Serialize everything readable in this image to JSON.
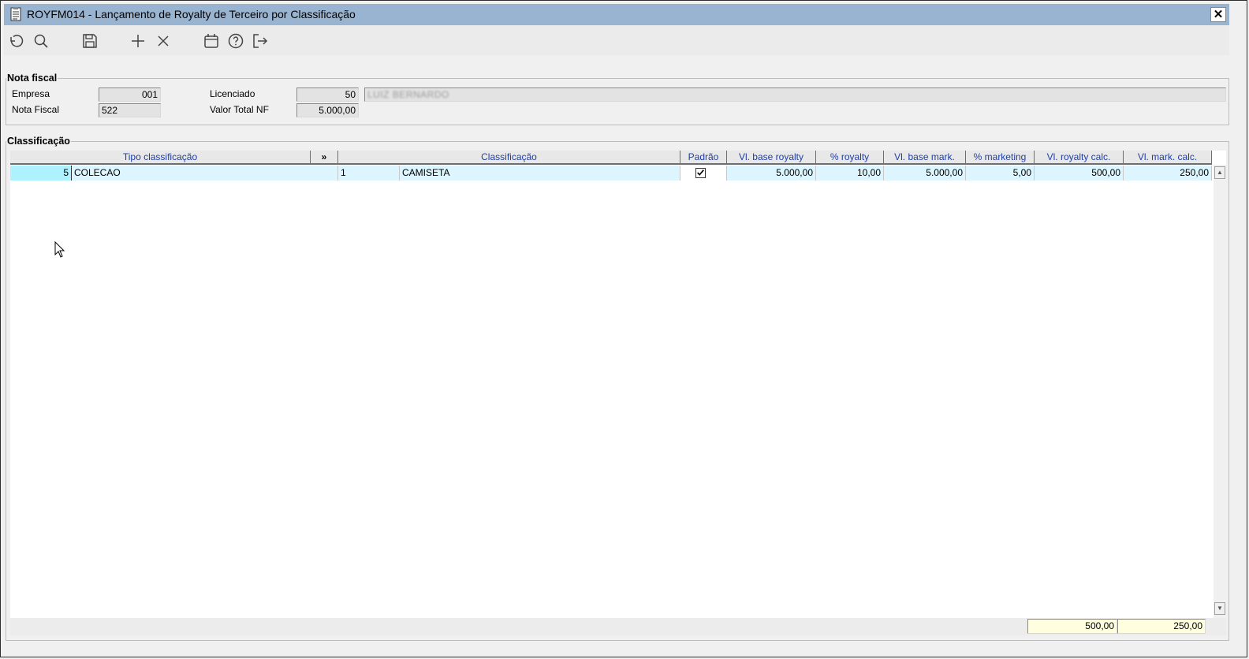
{
  "window": {
    "title": "ROYFM014 - Lançamento de Royalty de Terceiro por Classificação",
    "close_label": "✕"
  },
  "toolbar": {
    "icons": [
      "undo-icon",
      "search-icon",
      "save-icon",
      "add-icon",
      "delete-icon",
      "calendar-icon",
      "help-icon",
      "exit-icon"
    ]
  },
  "nota_fiscal": {
    "legend": "Nota fiscal",
    "empresa_label": "Empresa",
    "empresa_value": "001",
    "nota_label": "Nota Fiscal",
    "nota_value": "522",
    "licenciado_label": "Licenciado",
    "licenciado_code": "50",
    "licenciado_name": "LUIZ BERNARDO",
    "valor_label": "Valor Total NF",
    "valor_value": "5.000,00"
  },
  "classificacao": {
    "legend": "Classificação",
    "columns": {
      "tipo": "Tipo classificação",
      "expand": "»",
      "classificacao": "Classificação",
      "padrao": "Padrão",
      "vl_base_royalty": "Vl. base royalty",
      "pct_royalty": "% royalty",
      "vl_base_mark": "Vl. base mark.",
      "pct_marketing": "% marketing",
      "vl_royalty_calc": "Vl. royalty calc.",
      "vl_mark_calc": "Vl. mark. calc."
    },
    "rows": [
      {
        "tipo_code": "5",
        "tipo_desc": "COLECAO",
        "class_code": "1",
        "class_desc": "CAMISETA",
        "padrao": true,
        "vl_base_royalty": "5.000,00",
        "pct_royalty": "10,00",
        "vl_base_mark": "5.000,00",
        "pct_marketing": "5,00",
        "vl_royalty_calc": "500,00",
        "vl_mark_calc": "250,00"
      }
    ],
    "totals": {
      "royalty": "500,00",
      "mark": "250,00"
    }
  }
}
